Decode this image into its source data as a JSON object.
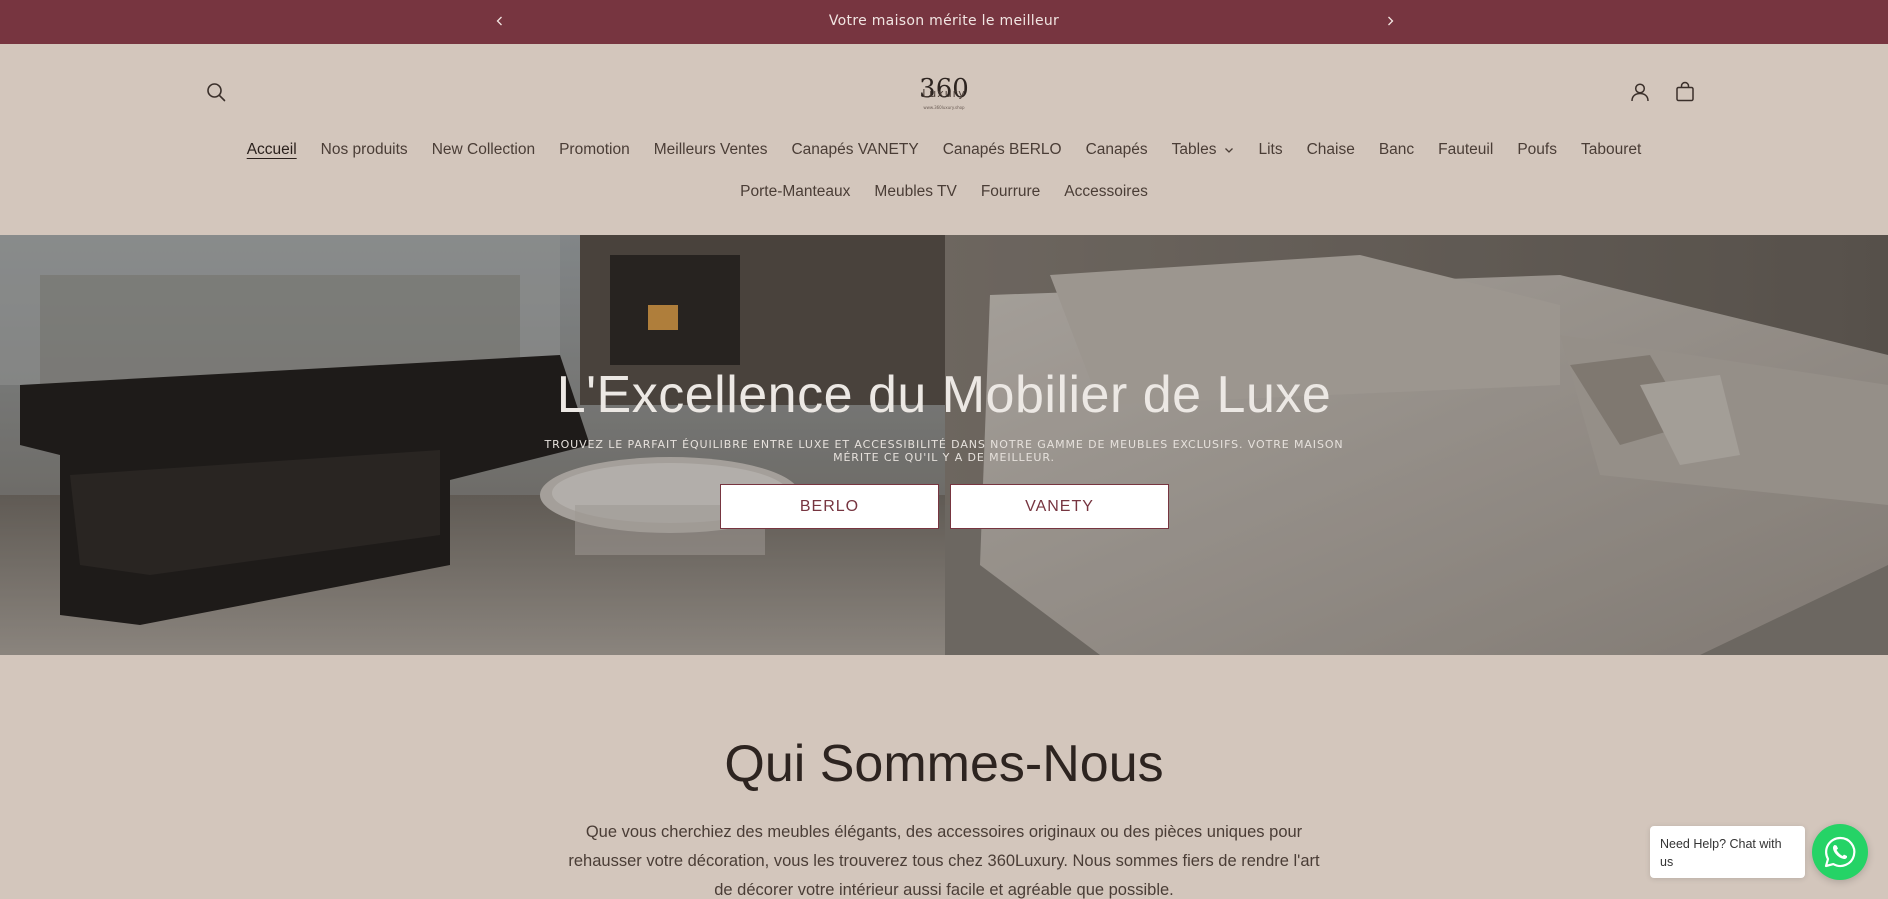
{
  "announcement": {
    "message": "Votre maison mérite le meilleur",
    "prev_icon": "chevron-left-icon",
    "next_icon": "chevron-right-icon"
  },
  "header": {
    "logo": {
      "text": "360",
      "subtext": "Luxury",
      "tagline": "www.360luxury.shop"
    },
    "search_icon": "search-icon",
    "account_icon": "user-icon",
    "cart_icon": "cart-icon"
  },
  "nav": {
    "row1": [
      {
        "label": "Accueil",
        "active": true
      },
      {
        "label": "Nos produits"
      },
      {
        "label": "New Collection"
      },
      {
        "label": "Promotion"
      },
      {
        "label": "Meilleurs Ventes"
      },
      {
        "label": "Canapés VANETY"
      },
      {
        "label": "Canapés BERLO"
      },
      {
        "label": "Canapés"
      },
      {
        "label": "Tables",
        "has_dropdown": true
      },
      {
        "label": "Lits"
      },
      {
        "label": "Chaise"
      },
      {
        "label": "Banc"
      },
      {
        "label": "Fauteuil"
      },
      {
        "label": "Poufs"
      },
      {
        "label": "Tabouret"
      }
    ],
    "row2": [
      {
        "label": "Porte-Manteaux"
      },
      {
        "label": "Meubles TV"
      },
      {
        "label": "Fourrure"
      },
      {
        "label": "Accessoires"
      }
    ]
  },
  "hero": {
    "title": "L'Excellence du Mobilier de Luxe",
    "subtitle": "Trouvez le parfait équilibre entre luxe et accessibilité dans notre gamme de meubles exclusifs. Votre maison mérite ce qu'il y a de meilleur.",
    "buttons": [
      {
        "label": "BERLO"
      },
      {
        "label": "VANETY"
      }
    ]
  },
  "about": {
    "title": "Qui Sommes-Nous",
    "text": "Que vous cherchiez des meubles élégants, des accessoires originaux ou des pièces uniques pour rehausser votre décoration, vous les trouverez tous chez 360Luxury. Nous sommes fiers de rendre l'art de décorer votre intérieur aussi facile et agréable que possible."
  },
  "chat": {
    "bubble_text": "Need Help? Chat with us",
    "icon": "whatsapp-icon"
  },
  "colors": {
    "brand": "#773540",
    "background": "#d3c6bc",
    "whatsapp": "#25d366"
  }
}
